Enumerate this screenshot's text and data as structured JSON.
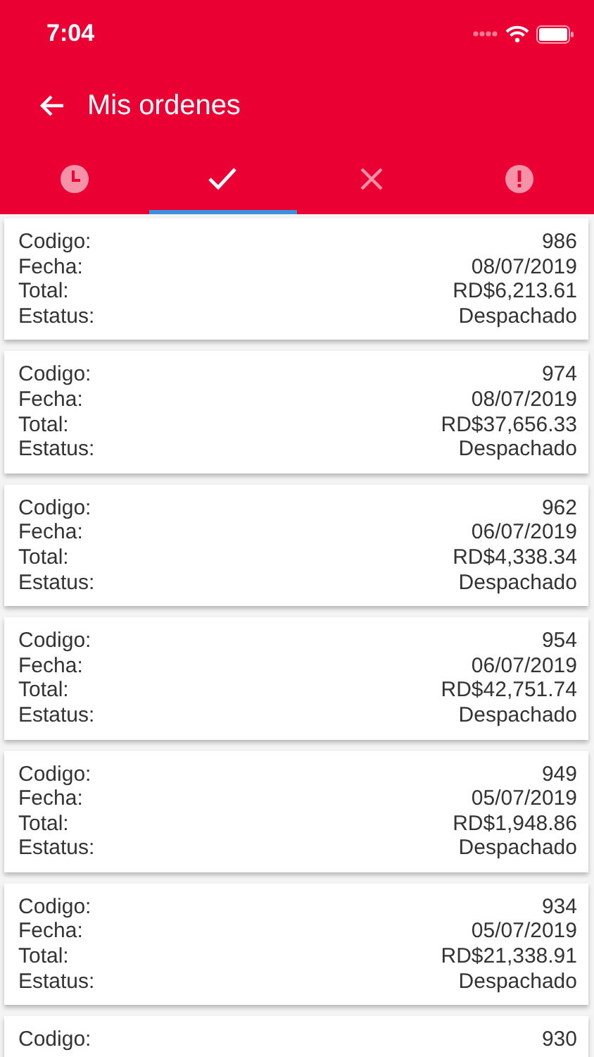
{
  "status_bar": {
    "time": "7:04"
  },
  "app_bar": {
    "title": "Mis ordenes"
  },
  "tabs": [
    {
      "kind": "clock",
      "selected": false
    },
    {
      "kind": "check",
      "selected": true
    },
    {
      "kind": "cross",
      "selected": false
    },
    {
      "kind": "alert",
      "selected": false
    }
  ],
  "orders": [
    {
      "fields": [
        {
          "label": "Codigo:",
          "value": "986"
        },
        {
          "label": "Fecha:",
          "value": "08/07/2019"
        },
        {
          "label": "Total:",
          "value": "RD$6,213.61"
        },
        {
          "label": "Estatus:",
          "value": "Despachado"
        }
      ]
    },
    {
      "fields": [
        {
          "label": "Codigo:",
          "value": "974"
        },
        {
          "label": "Fecha:",
          "value": "08/07/2019"
        },
        {
          "label": "Total:",
          "value": "RD$37,656.33"
        },
        {
          "label": "Estatus:",
          "value": "Despachado"
        }
      ]
    },
    {
      "fields": [
        {
          "label": "Codigo:",
          "value": "962"
        },
        {
          "label": "Fecha:",
          "value": "06/07/2019"
        },
        {
          "label": "Total:",
          "value": "RD$4,338.34"
        },
        {
          "label": "Estatus:",
          "value": "Despachado"
        }
      ]
    },
    {
      "fields": [
        {
          "label": "Codigo:",
          "value": "954"
        },
        {
          "label": "Fecha:",
          "value": "06/07/2019"
        },
        {
          "label": "Total:",
          "value": "RD$42,751.74"
        },
        {
          "label": "Estatus:",
          "value": "Despachado"
        }
      ]
    },
    {
      "fields": [
        {
          "label": "Codigo:",
          "value": "949"
        },
        {
          "label": "Fecha:",
          "value": "05/07/2019"
        },
        {
          "label": "Total:",
          "value": "RD$1,948.86"
        },
        {
          "label": "Estatus:",
          "value": "Despachado"
        }
      ]
    },
    {
      "fields": [
        {
          "label": "Codigo:",
          "value": "934"
        },
        {
          "label": "Fecha:",
          "value": "05/07/2019"
        },
        {
          "label": "Total:",
          "value": "RD$21,338.91"
        },
        {
          "label": "Estatus:",
          "value": "Despachado"
        }
      ]
    },
    {
      "fields": [
        {
          "label": "Codigo:",
          "value": "930"
        }
      ]
    }
  ]
}
